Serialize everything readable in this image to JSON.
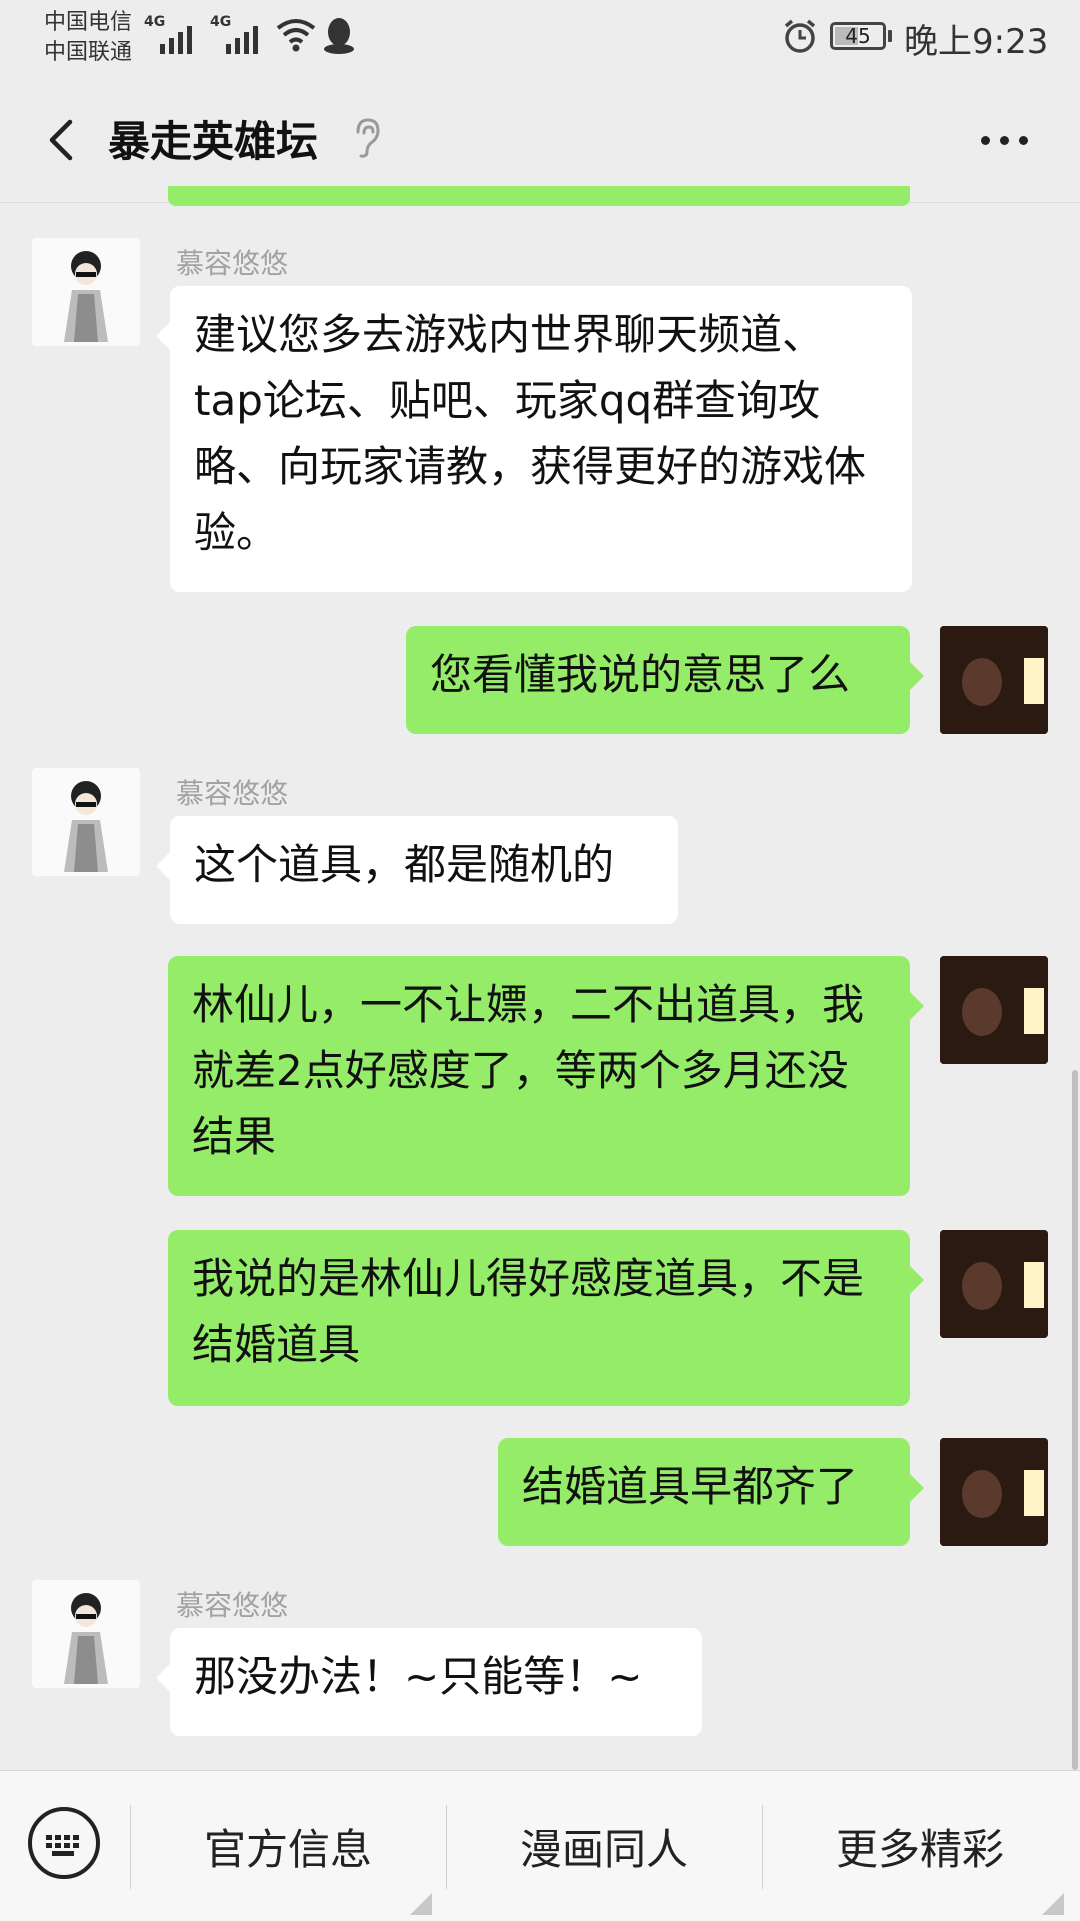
{
  "status_bar": {
    "carrier_1": "中国电信",
    "carrier_2": "中国联通",
    "network_1": "4G",
    "network_2": "4G",
    "battery": "45",
    "time": "晚上9:23",
    "icons": [
      "signal-icon",
      "wifi-icon",
      "qq-icon",
      "alarm-icon",
      "battery-icon"
    ]
  },
  "header": {
    "title": "暴走英雄坛",
    "back_icon": "chevron-left-icon",
    "voice_mode_icon": "ear-icon",
    "more_icon": "more-dots-icon"
  },
  "messages": [
    {
      "from": "other",
      "sender": "慕容悠悠",
      "text": "建议您多去游戏内世界聊天频道、tap论坛、贴吧、玩家qq群查询攻略、向玩家请教，获得更好的游戏体验。"
    },
    {
      "from": "me",
      "text": "您看懂我说的意思了么"
    },
    {
      "from": "other",
      "sender": "慕容悠悠",
      "text": "这个道具，都是随机的"
    },
    {
      "from": "me",
      "text": "林仙儿，一不让嫖，二不出道具，我就差2点好感度了，等两个多月还没结果"
    },
    {
      "from": "me",
      "text": "我说的是林仙儿得好感度道具，不是结婚道具"
    },
    {
      "from": "me",
      "text": "结婚道具早都齐了"
    },
    {
      "from": "other",
      "sender": "慕容悠悠",
      "text": "那没办法！~只能等！~"
    }
  ],
  "bottom_menu": {
    "keyboard_icon": "keyboard-icon",
    "items": [
      {
        "label": "官方信息"
      },
      {
        "label": "漫画同人"
      },
      {
        "label": "更多精彩"
      }
    ]
  },
  "colors": {
    "background": "#ededed",
    "my_bubble": "#95ec69",
    "other_bubble": "#ffffff"
  }
}
